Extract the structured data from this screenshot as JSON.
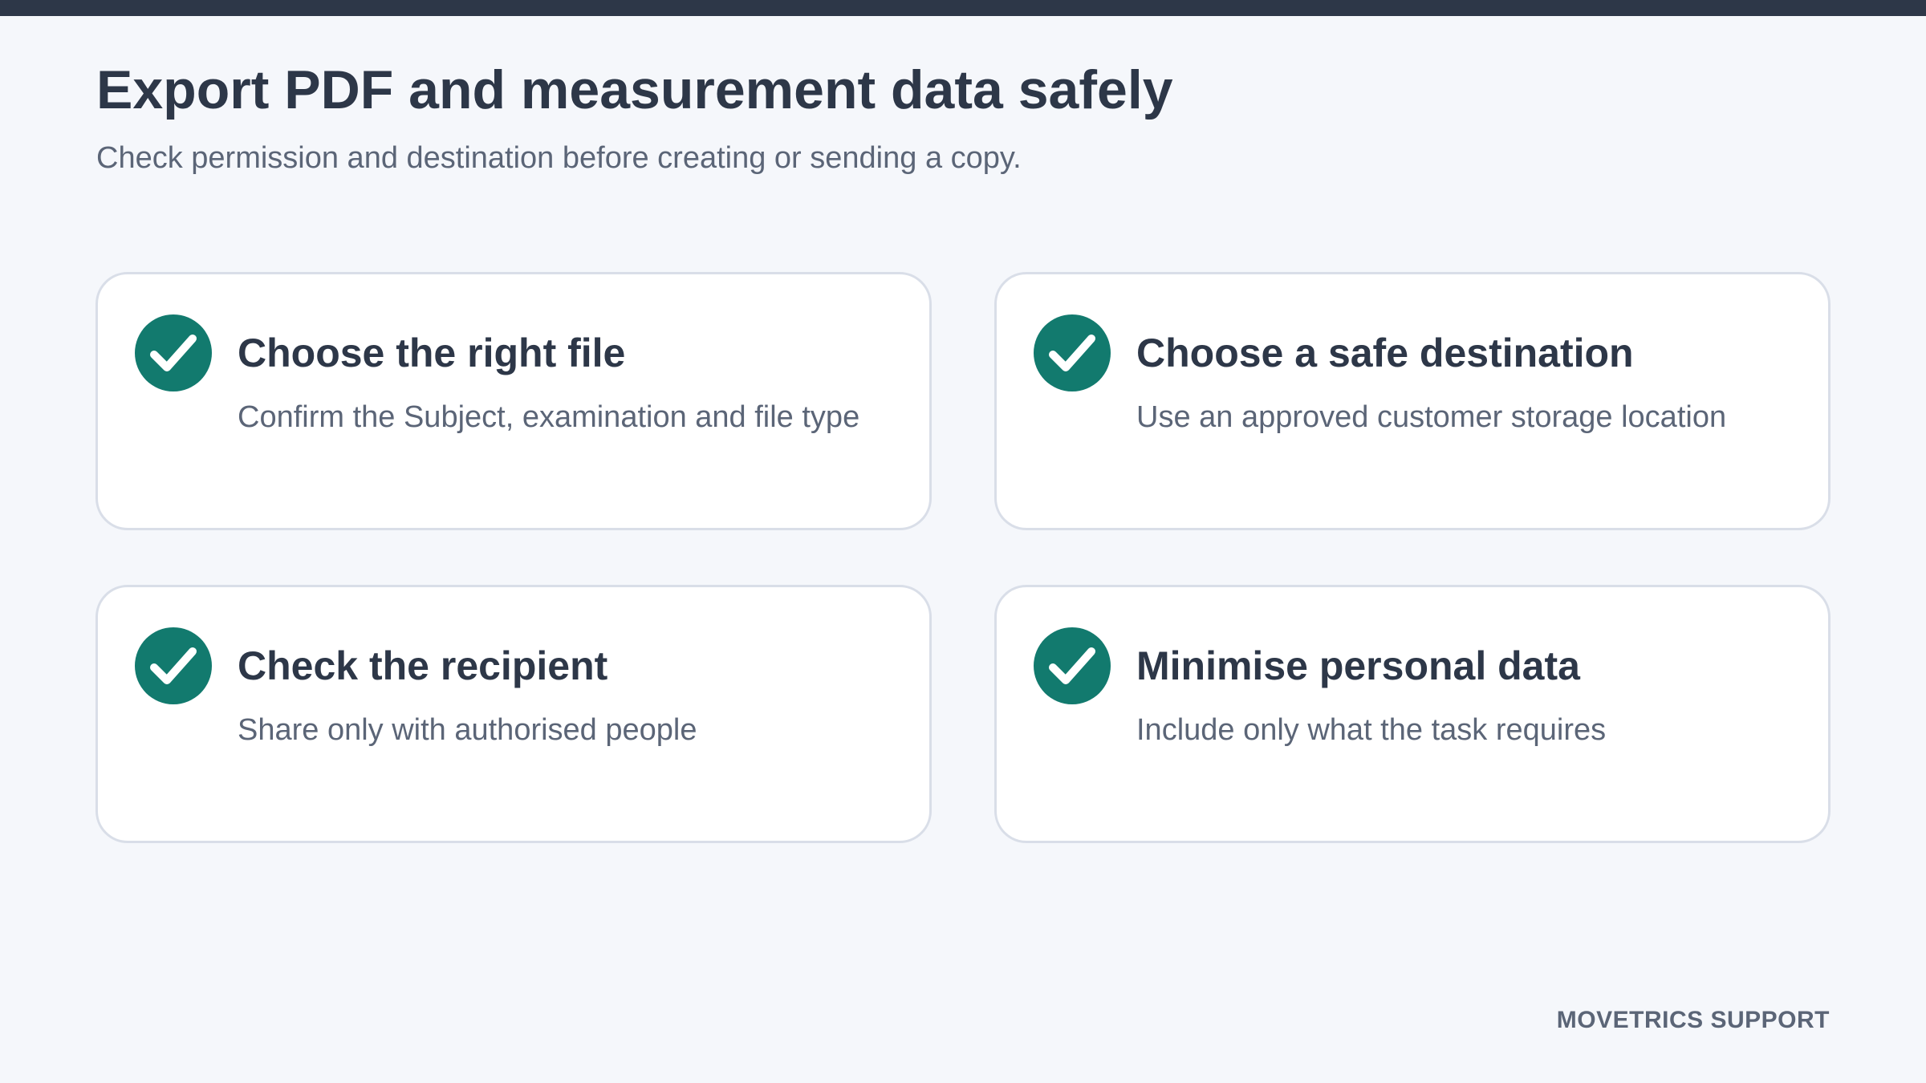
{
  "header": {
    "title": "Export PDF and measurement data safely",
    "subtitle": "Check permission and destination before creating or sending a copy."
  },
  "theme": {
    "accent": "#127a6e",
    "top_bar": "#2d3748",
    "background": "#f5f7fb"
  },
  "cards": [
    {
      "icon": "check-circle-icon",
      "title": "Choose the right file",
      "description": "Confirm the Subject, examination and file type"
    },
    {
      "icon": "check-circle-icon",
      "title": "Choose a safe destination",
      "description": "Use an approved customer storage location"
    },
    {
      "icon": "check-circle-icon",
      "title": "Check the recipient",
      "description": "Share only with authorised people"
    },
    {
      "icon": "check-circle-icon",
      "title": "Minimise personal data",
      "description": "Include only what the task requires"
    }
  ],
  "footer": {
    "brand": "MOVETRICS SUPPORT"
  }
}
